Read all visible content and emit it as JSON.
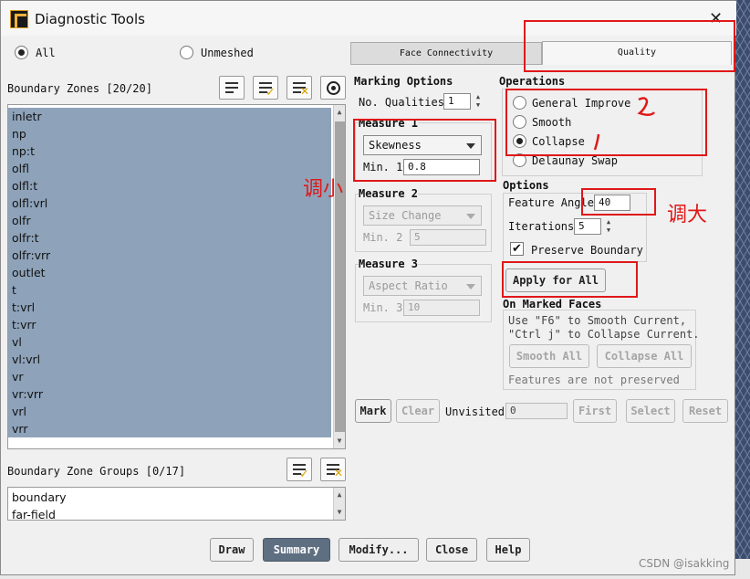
{
  "window": {
    "title": "Diagnostic Tools",
    "close": "✕"
  },
  "filter": {
    "all_label": "All",
    "unmeshed_label": "Unmeshed"
  },
  "boundary_zones": {
    "header": "Boundary Zones [20/20]",
    "items": [
      "inletr",
      "np",
      "np:t",
      "olfl",
      "olfl:t",
      "olfl:vrl",
      "olfr",
      "olfr:t",
      "olfr:vrr",
      "outlet",
      "t",
      "t:vrl",
      "t:vrr",
      "vl",
      "vl:vrl",
      "vr",
      "vr:vrr",
      "vrl",
      "vrr"
    ]
  },
  "zone_groups": {
    "header": "Boundary Zone Groups [0/17]",
    "items": [
      "boundary",
      "far-field"
    ]
  },
  "tabs": [
    {
      "label": "Face Connectivity"
    },
    {
      "label": "Quality"
    }
  ],
  "marking": {
    "title": "Marking Options",
    "no_qualities_label": "No. Qualities",
    "no_qualities_value": "1",
    "measure1": {
      "title": "Measure 1",
      "measure": "Skewness",
      "min_label": "Min. 1",
      "min_value": "0.8"
    },
    "measure2": {
      "title": "Measure 2",
      "measure": "Size Change",
      "min_label": "Min. 2",
      "min_value": "5"
    },
    "measure3": {
      "title": "Measure 3",
      "measure": "Aspect Ratio",
      "min_label": "Min. 3",
      "min_value": "10"
    }
  },
  "operations": {
    "title": "Operations",
    "items": [
      "General Improve",
      "Smooth",
      "Collapse",
      "Delaunay Swap"
    ],
    "selected": "Collapse"
  },
  "options": {
    "title": "Options",
    "feature_angle_label": "Feature Angle",
    "feature_angle_value": "40",
    "iterations_label": "Iterations",
    "iterations_value": "5",
    "preserve_boundary_label": "Preserve Boundary",
    "preserve_boundary_checked": true,
    "check_glyph": "✔"
  },
  "apply_all": "Apply for All",
  "marked_faces": {
    "title": "On Marked Faces",
    "hint1": "Use \"F6\" to Smooth Current,",
    "hint2": "\"Ctrl j\" to Collapse Current.",
    "smooth_all": "Smooth All",
    "collapse_all": "Collapse All",
    "note": "Features are not preserved"
  },
  "mark_row": {
    "mark": "Mark",
    "clear": "Clear",
    "unvisited_label": "Unvisited",
    "unvisited_value": "0",
    "first": "First",
    "select": "Select",
    "reset": "Reset"
  },
  "footer": [
    "Draw",
    "Summary",
    "Modify...",
    "Close",
    "Help"
  ],
  "annotations": {
    "reduce": "调小",
    "increase": "调大"
  },
  "watermark": "CSDN @isakking",
  "colors": {
    "selection": "#8ea3ba",
    "annotation": "#e01818",
    "primary_button": "#5f6f82"
  }
}
